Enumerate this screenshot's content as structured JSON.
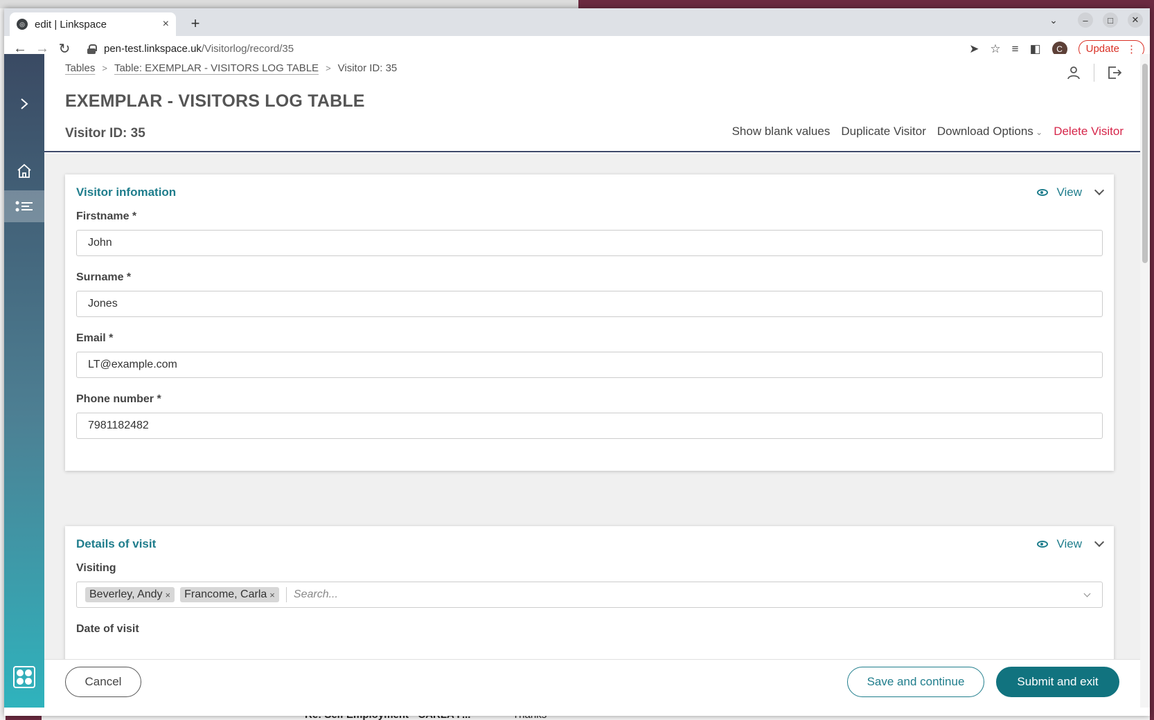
{
  "browser": {
    "tab_title": "edit | Linkspace",
    "tab_close": "×",
    "new_tab": "+",
    "url_host": "pen-test.linkspace.uk",
    "url_path": "/Visitorlog/record/35",
    "profile_initial": "C",
    "update_label": "Update"
  },
  "breadcrumb": {
    "tables": "Tables",
    "table": "Table: EXEMPLAR - VISITORS LOG TABLE",
    "current": "Visitor ID: 35"
  },
  "page": {
    "title": "EXEMPLAR - VISITORS LOG TABLE",
    "record_id": "Visitor ID: 35"
  },
  "actions": {
    "show_blank": "Show blank values",
    "duplicate": "Duplicate Visitor",
    "download": "Download Options",
    "delete": "Delete Visitor"
  },
  "sections": [
    {
      "title": "Visitor infomation",
      "view_label": "View",
      "fields": [
        {
          "label": "Firstname *",
          "value": "John"
        },
        {
          "label": "Surname *",
          "value": "Jones"
        },
        {
          "label": "Email *",
          "value": "LT@example.com"
        },
        {
          "label": "Phone number *",
          "value": "7981182482"
        }
      ]
    },
    {
      "title": "Details of visit",
      "view_label": "View",
      "visiting_label": "Visiting",
      "visiting_values": [
        "Beverley, Andy",
        "Francome, Carla"
      ],
      "search_placeholder": "Search...",
      "next_label": "Date of visit"
    }
  ],
  "footer": {
    "cancel": "Cancel",
    "save_continue": "Save and continue",
    "submit_exit": "Submit and exit"
  },
  "background": {
    "email_subject": "Re: Self Employment - CARLA F...",
    "email_preview": "Thanks"
  },
  "colors": {
    "accent": "#1f7d8c",
    "primary_button": "#11737f",
    "danger": "#d6264a",
    "sidebar_top": "#3a4a63",
    "sidebar_bottom": "#2fb3bd"
  },
  "icons": [
    "expand-icon",
    "home-icon",
    "list-icon",
    "user-icon",
    "logout-icon",
    "eye-icon",
    "chevron-down-icon"
  ]
}
